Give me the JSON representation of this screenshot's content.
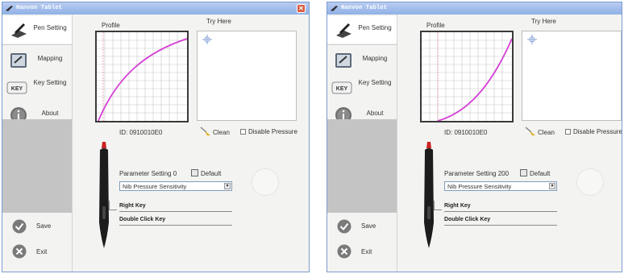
{
  "colors": {
    "titlebar": "#8fb0e6",
    "curve": "#d53fd5",
    "grid": "#c8c8c8",
    "sidebar_gray": "#c4c4c4"
  },
  "left": {
    "window_title": "Hanvon Tablet",
    "sidebar": {
      "pen_setting": "Pen Setting",
      "mapping": "Mapping",
      "key_setting": "Key Setting",
      "key_badge": "KEY",
      "about": "About",
      "save": "Save",
      "exit": "Exit"
    },
    "profile_label": "Profile",
    "try_here_label": "Try Here",
    "device_id": "ID: 0910010E0",
    "clean_label": "Clean",
    "disable_pressure_label": "Disable Pressure",
    "parameter_setting": "Parameter Setting",
    "parameter_value": "0",
    "default_label": "Default",
    "dropdown_value": "Nib Pressure Sensitivity",
    "right_key": "Right Key",
    "double_click_key": "Double Click Key",
    "curve_shape": "concave",
    "icons": {
      "close": "close-icon",
      "pen_setting": "pen-tablet-icon",
      "mapping": "mapping-icon",
      "key": "key-icon",
      "about": "info-icon",
      "save": "check-icon",
      "exit": "x-icon",
      "clean": "broom-icon",
      "cursor": "crosshair-icon"
    }
  },
  "right": {
    "window_title": "Hanvon Tablet",
    "sidebar": {
      "pen_setting": "Pen Setting",
      "mapping": "Mapping",
      "key_setting": "Key Setting",
      "key_badge": "KEY",
      "about": "About",
      "save": "Save",
      "exit": "Exit"
    },
    "profile_label": "Profile",
    "try_here_label": "Try Here",
    "device_id": "ID: 0910010E0",
    "clean_label": "Clean",
    "disable_pressure_label": "Disable Pressure",
    "parameter_setting": "Parameter Setting",
    "parameter_value": "200",
    "default_label": "Default",
    "dropdown_value": "Nib Pressure Sensitivity",
    "right_key": "Right Key",
    "double_click_key": "Double Click Key",
    "curve_shape": "convex"
  }
}
